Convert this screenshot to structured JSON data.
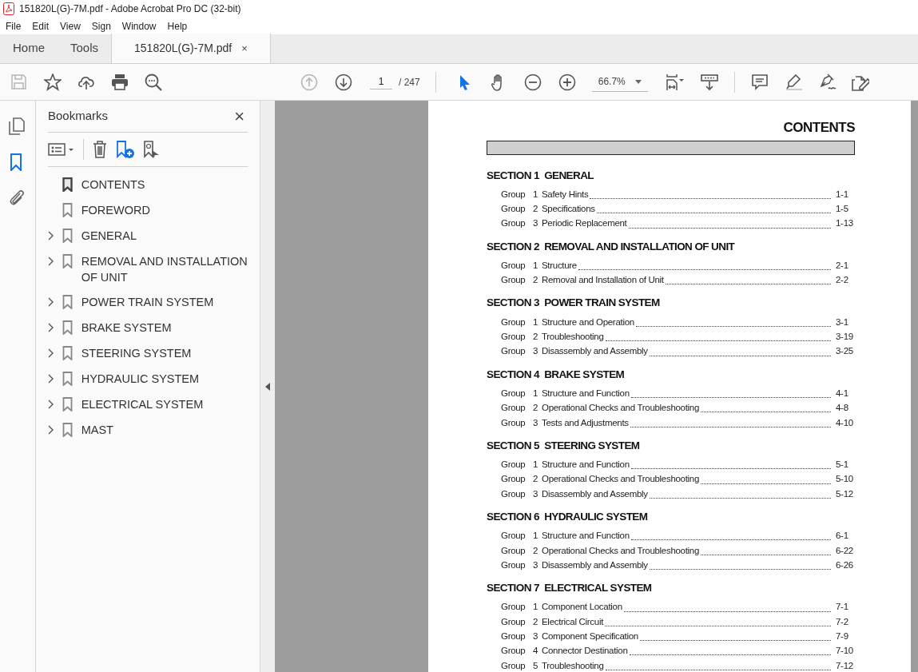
{
  "window": {
    "title": "151820L(G)-7M.pdf - Adobe Acrobat Pro DC (32-bit)"
  },
  "menu": [
    "File",
    "Edit",
    "View",
    "Sign",
    "Window",
    "Help"
  ],
  "tabs": [
    {
      "label": "Home",
      "selected": false,
      "closable": false
    },
    {
      "label": "Tools",
      "selected": false,
      "closable": false
    },
    {
      "label": "151820L(G)-7M.pdf",
      "selected": true,
      "closable": true,
      "close": "×"
    }
  ],
  "toolbar": {
    "left": [
      {
        "kind": "save",
        "disabled": true
      },
      {
        "kind": "star",
        "disabled": false
      },
      {
        "kind": "upload",
        "disabled": false
      },
      {
        "kind": "print",
        "disabled": false
      },
      {
        "kind": "find",
        "disabled": false
      }
    ],
    "nav": [
      {
        "kind": "prev",
        "disabled": true
      },
      {
        "kind": "next",
        "disabled": false
      }
    ],
    "page_field": "1",
    "page_total": "/ 247",
    "tools": [
      {
        "kind": "select",
        "selected": true
      },
      {
        "kind": "hand",
        "selected": false
      },
      {
        "kind": "zoom-out",
        "selected": false
      },
      {
        "kind": "zoom-in",
        "selected": false
      }
    ],
    "zoom": "66.7%",
    "right": [
      {
        "kind": "fit"
      },
      {
        "kind": "scroll"
      },
      {
        "kind": "sep"
      },
      {
        "kind": "comment"
      },
      {
        "kind": "highlight"
      },
      {
        "kind": "sign"
      },
      {
        "kind": "edit"
      }
    ]
  },
  "rail": [
    {
      "kind": "pages",
      "selected": false
    },
    {
      "kind": "bookmarks",
      "selected": true
    },
    {
      "kind": "attachments",
      "selected": false
    }
  ],
  "bookmarks": {
    "title": "Bookmarks",
    "close": "×",
    "items": [
      {
        "label": "CONTENTS",
        "expandable": false,
        "selected": true
      },
      {
        "label": "FOREWORD",
        "expandable": false,
        "selected": false
      },
      {
        "label": "GENERAL",
        "expandable": true,
        "selected": false
      },
      {
        "label": "REMOVAL AND INSTALLATION OF UNIT",
        "expandable": true,
        "selected": false
      },
      {
        "label": "POWER TRAIN SYSTEM",
        "expandable": true,
        "selected": false
      },
      {
        "label": "BRAKE SYSTEM",
        "expandable": true,
        "selected": false
      },
      {
        "label": "STEERING SYSTEM",
        "expandable": true,
        "selected": false
      },
      {
        "label": "HYDRAULIC SYSTEM",
        "expandable": true,
        "selected": false
      },
      {
        "label": "ELECTRICAL SYSTEM",
        "expandable": true,
        "selected": false
      },
      {
        "label": "MAST",
        "expandable": true,
        "selected": false
      }
    ]
  },
  "document": {
    "title": "CONTENTS",
    "sections": [
      {
        "heading": "SECTION 1  GENERAL",
        "groups": [
          [
            "Group",
            "1",
            "Safety Hints",
            "1-1"
          ],
          [
            "Group",
            "2",
            "Specifications",
            "1-5"
          ],
          [
            "Group",
            "3",
            "Periodic Replacement",
            "1-13"
          ]
        ]
      },
      {
        "heading": "SECTION 2  REMOVAL AND INSTALLATION OF UNIT",
        "groups": [
          [
            "Group",
            "1",
            "Structure",
            "2-1"
          ],
          [
            "Group",
            "2",
            "Removal and Installation of Unit",
            "2-2"
          ]
        ]
      },
      {
        "heading": "SECTION 3  POWER TRAIN SYSTEM",
        "groups": [
          [
            "Group",
            "1",
            "Structure and Operation",
            "3-1"
          ],
          [
            "Group",
            "2",
            "Troubleshooting",
            "3-19"
          ],
          [
            "Group",
            "3",
            "Disassembly and Assembly",
            "3-25"
          ]
        ]
      },
      {
        "heading": "SECTION 4  BRAKE SYSTEM",
        "groups": [
          [
            "Group",
            "1",
            "Structure and Function",
            "4-1"
          ],
          [
            "Group",
            "2",
            "Operational Checks and Troubleshooting",
            "4-8"
          ],
          [
            "Group",
            "3",
            "Tests and Adjustments",
            "4-10"
          ]
        ]
      },
      {
        "heading": "SECTION 5  STEERING SYSTEM",
        "groups": [
          [
            "Group",
            "1",
            "Structure and Function",
            "5-1"
          ],
          [
            "Group",
            "2",
            "Operational Checks and Troubleshooting",
            "5-10"
          ],
          [
            "Group",
            "3",
            "Disassembly and Assembly",
            "5-12"
          ]
        ]
      },
      {
        "heading": "SECTION 6  HYDRAULIC SYSTEM",
        "groups": [
          [
            "Group",
            "1",
            "Structure and Function",
            "6-1"
          ],
          [
            "Group",
            "2",
            "Operational Checks and Troubleshooting",
            "6-22"
          ],
          [
            "Group",
            "3",
            "Disassembly and Assembly",
            "6-26"
          ]
        ]
      },
      {
        "heading": "SECTION 7  ELECTRICAL SYSTEM",
        "groups": [
          [
            "Group",
            "1",
            "Component Location",
            "7-1"
          ],
          [
            "Group",
            "2",
            "Electrical Circuit",
            "7-2"
          ],
          [
            "Group",
            "3",
            "Component Specification",
            "7-9"
          ],
          [
            "Group",
            "4",
            "Connector Destination",
            "7-10"
          ],
          [
            "Group",
            "5",
            "Troubleshooting",
            "7-12"
          ]
        ]
      }
    ]
  }
}
